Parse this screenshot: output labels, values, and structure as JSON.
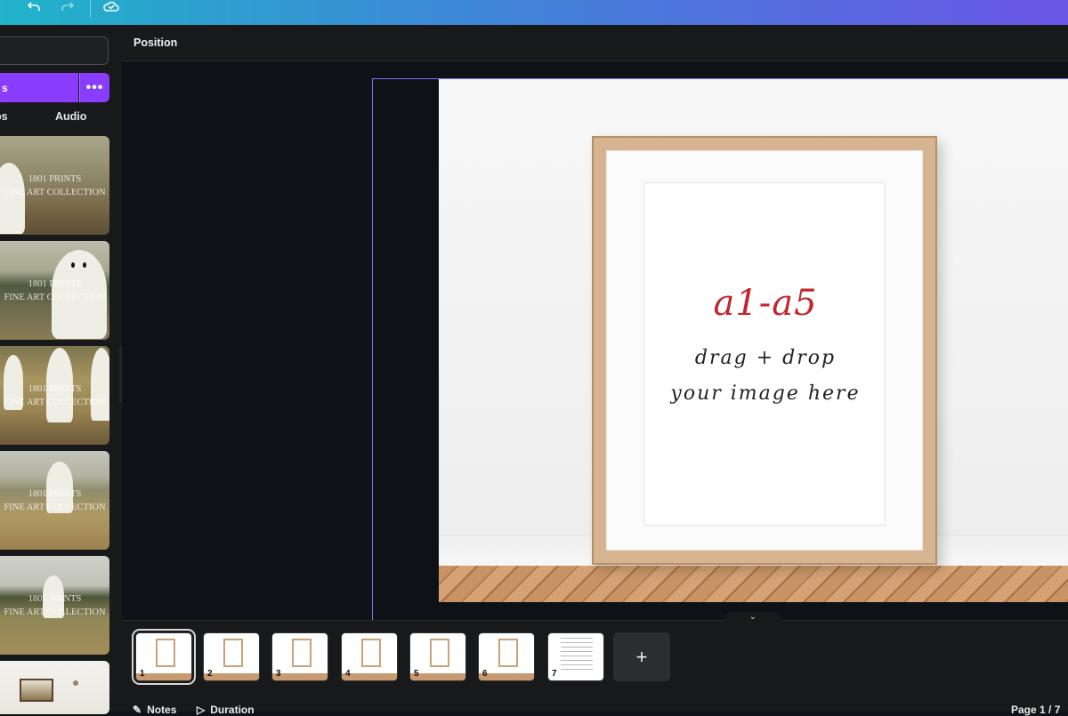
{
  "toolbar": {
    "undo_icon": "undo-icon",
    "redo_icon": "redo-icon",
    "save_icon": "cloud-check-icon"
  },
  "sidebar": {
    "primary_button_label": "s",
    "more_button_label": "•••",
    "tabs": [
      {
        "label": "os"
      },
      {
        "label": "Audio"
      }
    ],
    "thumbnails": [
      {
        "watermark_line1": "1801 PRINTS",
        "watermark_line2": "FINE ART COLLECTION"
      },
      {
        "watermark_line1": "1801 PRINTS",
        "watermark_line2": "FINE ART COLLECTION"
      },
      {
        "watermark_line1": "1801 PRINTS",
        "watermark_line2": "FINE ART COLLECTION"
      },
      {
        "watermark_line1": "1801 PRINTS",
        "watermark_line2": "FINE ART COLLECTION"
      },
      {
        "watermark_line1": "1801 PRINTS",
        "watermark_line2": "FINE ART COLLECTION"
      }
    ]
  },
  "secondary_toolbar": {
    "position_label": "Position"
  },
  "canvas": {
    "headline": "a1-a5",
    "line1": "drag + drop",
    "line2": "your image here"
  },
  "pages": {
    "numbers": [
      "1",
      "2",
      "3",
      "4",
      "5",
      "6",
      "7"
    ],
    "selected_index": 0,
    "add_label": "+"
  },
  "bottombar": {
    "notes_label": "Notes",
    "duration_label": "Duration",
    "page_indicator": "Page 1 / 7"
  },
  "colors": {
    "accent": "#8b3dff",
    "selection_outline": "#8b6cff",
    "headline_red": "#c3262f"
  }
}
